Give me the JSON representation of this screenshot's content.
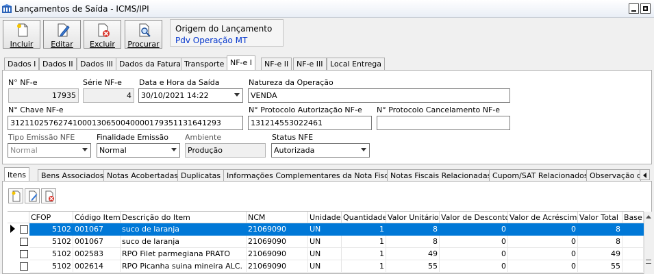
{
  "window": {
    "title": "Lançamentos de Saída - ICMS/IPI"
  },
  "toolbar": {
    "incluir": "Incluir",
    "editar": "Editar",
    "excluir": "Excluir",
    "procurar": "Procurar"
  },
  "origem": {
    "label": "Origem do Lançamento",
    "value": "Pdv Operação MT"
  },
  "tabs": [
    "Dados I",
    "Dados II",
    "Dados III",
    "Dados da Fatura",
    "Transporte",
    "NF-e I",
    "NF-e II",
    "NF-e III",
    "Local Entrega"
  ],
  "nfe": {
    "numero_label": "N° NF-e",
    "numero": "17935",
    "serie_label": "Série NF-e",
    "serie": "4",
    "data_label": "Data e Hora da Saída",
    "data": "30/10/2021 14:22",
    "natureza_label": "Natureza da Operação",
    "natureza": "VENDA",
    "chave_label": "N° Chave NF-e",
    "chave": "31211025762741000130650040000179351131641293",
    "protocolo_label": "N° Protocolo Autorização NF-e",
    "protocolo": "131214553022461",
    "cancelamento_label": "N° Protocolo Cancelamento NF-e",
    "cancelamento": "",
    "tipo_label": "Tipo Emissão NFE",
    "tipo": "Normal",
    "finalidade_label": "Finalidade Emissão",
    "finalidade": "Normal",
    "ambiente_label": "Ambiente",
    "ambiente": "Produção",
    "status_label": "Status NFE",
    "status": "Autorizada"
  },
  "subtabs": [
    "Itens",
    "Bens Associados",
    "Notas Acobertadas",
    "Duplicatas",
    "Informações Complementares da Nota Fiscal",
    "Notas Fiscais Relacionadas",
    "Cupom/SAT Relacionados",
    "Observação d"
  ],
  "grid": {
    "columns": [
      "CFOP",
      "Código Item",
      "Descrição do Item",
      "NCM",
      "Unidade",
      "Quantidade",
      "Valor Unitário",
      "Valor de Desconto",
      "Valor de Acréscimo",
      "Valor Total",
      "Base c"
    ],
    "rows": [
      [
        "5102",
        "001067",
        "suco de laranja",
        "21069090",
        "UN",
        "1",
        "8",
        "0",
        "0",
        "8"
      ],
      [
        "5102",
        "001067",
        "suco de laranja",
        "21069090",
        "UN",
        "1",
        "8",
        "0",
        "0",
        "8"
      ],
      [
        "5102",
        "002583",
        "RPO Filet parmegiana PRATO",
        "21069090",
        "UN",
        "1",
        "49",
        "0",
        "0",
        "49"
      ],
      [
        "5102",
        "002614",
        "RPO Picanha suina mineira ALC.",
        "21069090",
        "UN",
        "1",
        "55",
        "0",
        "0",
        "55"
      ]
    ]
  },
  "colors": {
    "selection": "#0078d7",
    "link": "#0033cc"
  }
}
